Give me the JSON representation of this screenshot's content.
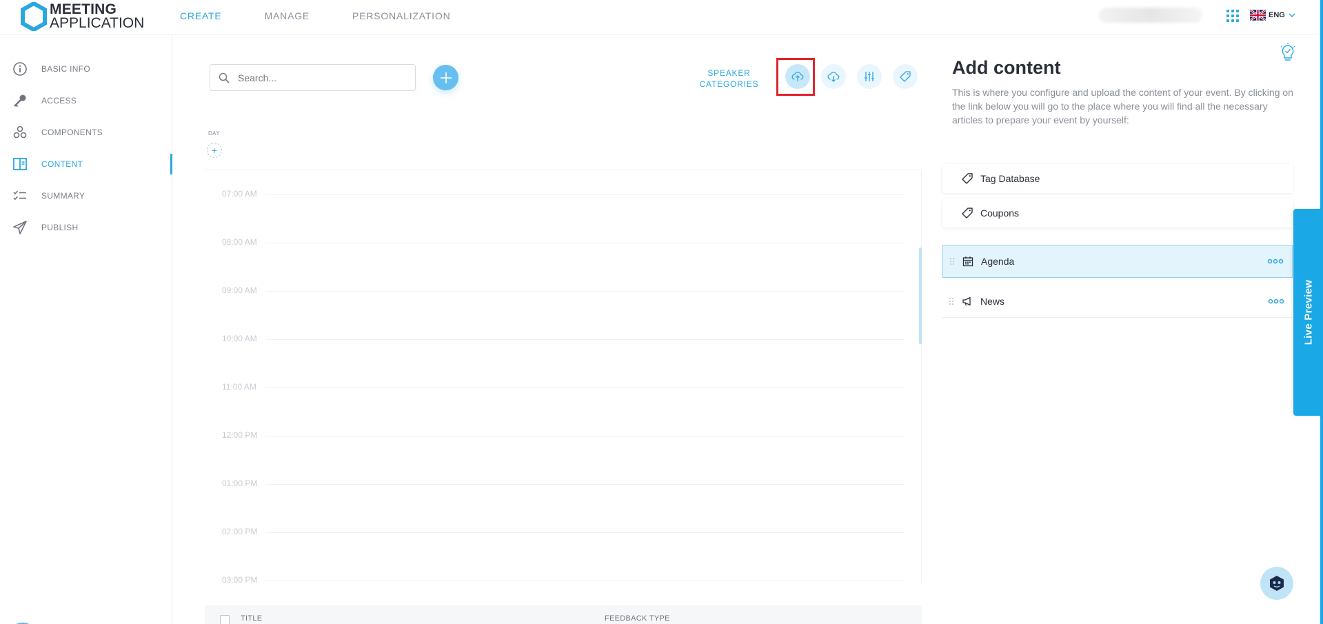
{
  "app": {
    "logo_line1": "MEETING",
    "logo_line2": "APPLICATION"
  },
  "topnav": {
    "items": [
      {
        "label": "CREATE",
        "active": true
      },
      {
        "label": "MANAGE",
        "active": false
      },
      {
        "label": "PERSONALIZATION",
        "active": false
      }
    ]
  },
  "header_right": {
    "language": "ENG",
    "apps_icon": "grid-icon",
    "flag_icon": "uk-flag-icon"
  },
  "sidebar": {
    "items": [
      {
        "label": "BASIC INFO",
        "icon": "info-icon",
        "active": false
      },
      {
        "label": "ACCESS",
        "icon": "key-icon",
        "active": false
      },
      {
        "label": "COMPONENTS",
        "icon": "components-icon",
        "active": false
      },
      {
        "label": "CONTENT",
        "icon": "content-icon",
        "active": true
      },
      {
        "label": "SUMMARY",
        "icon": "checklist-icon",
        "active": false
      },
      {
        "label": "PUBLISH",
        "icon": "send-icon",
        "active": false
      }
    ]
  },
  "toolbar": {
    "search_placeholder": "Search...",
    "speaker_categories_line1": "SPEAKER",
    "speaker_categories_line2": "CATEGORIES",
    "tools": [
      "cloud-upload-icon",
      "cloud-download-icon",
      "sliders-icon",
      "tag-icon"
    ]
  },
  "schedule": {
    "day_label": "DAY",
    "day_add": "+",
    "times": [
      "07:00 AM",
      "08:00 AM",
      "09:00 AM",
      "10:00 AM",
      "11:00 AM",
      "12:00 PM",
      "01:00 PM",
      "02:00 PM",
      "03:00 PM"
    ]
  },
  "table": {
    "col_title": "TITLE",
    "col_feedback": "FEEDBACK TYPE"
  },
  "panel": {
    "title": "Add content",
    "description": "This is where you configure and upload the content of your event. By clicking on the link below you will go to the place where you will find all the necessary articles to prepare your event by yourself:",
    "links": [
      {
        "label": "Tag Database",
        "icon": "tag-icon"
      },
      {
        "label": "Coupons",
        "icon": "tag-icon"
      }
    ],
    "modules": [
      {
        "label": "Agenda",
        "icon": "calendar-icon",
        "selected": true
      },
      {
        "label": "News",
        "icon": "megaphone-icon",
        "selected": false
      }
    ]
  },
  "live_preview": "Live Preview",
  "colors": {
    "accent": "#2aa7e0",
    "accent_light": "#e4f4fc",
    "highlight": "#e0242e",
    "text_dark": "#2b2f3a"
  }
}
